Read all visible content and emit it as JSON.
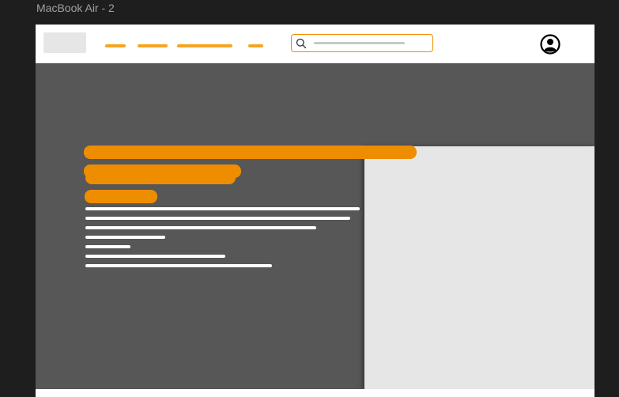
{
  "frame": {
    "title": "MacBook Air - 2"
  },
  "colors": {
    "accent": "#ee8d00",
    "hero_background": "#575757",
    "image_placeholder": "#e6e6e6",
    "text_line": "#ffffff",
    "canvas_background": "#1e1e1e"
  },
  "navbar": {
    "logo_icon": "logo-placeholder",
    "nav_link_count": 4,
    "search_icon": "search-icon",
    "avatar_icon": "user-circle-icon"
  },
  "hero": {
    "headline_bar_count": 3,
    "body_line_count": 7,
    "image_icon": "image-placeholder"
  }
}
